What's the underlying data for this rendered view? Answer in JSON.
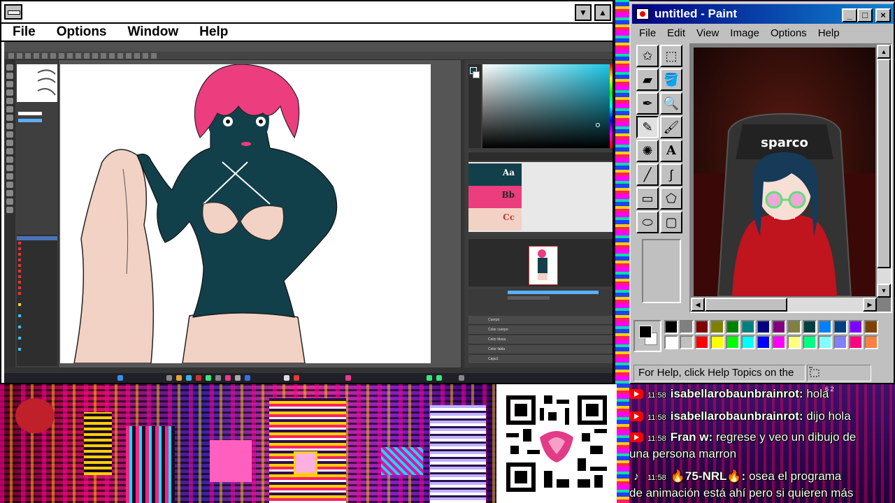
{
  "left_window": {
    "menu": [
      "File",
      "Options",
      "Window",
      "Help"
    ],
    "scroll_up": "▼",
    "scroll_down": "▲"
  },
  "paint": {
    "title": "untitled - Paint",
    "menu": [
      "File",
      "Edit",
      "View",
      "Image",
      "Options",
      "Help"
    ],
    "minimize": "_",
    "maximize": "□",
    "close": "×",
    "tools": [
      "free-select",
      "select",
      "eraser",
      "fill",
      "color-picker",
      "magnifier",
      "pencil",
      "brush",
      "airbrush",
      "text",
      "line",
      "curve",
      "rectangle",
      "polygon",
      "ellipse",
      "rounded-rectangle"
    ],
    "tool_glyphs": [
      "✩",
      "⬚",
      "▰",
      "🪣",
      "✒",
      "🔍",
      "✎",
      "🖌",
      "✺",
      "A",
      "╱",
      "∫",
      "▭",
      "⬠",
      "⬭",
      "▢"
    ],
    "active_tool": 6,
    "status": "For Help, click Help Topics on the",
    "sparco_text": "sparco",
    "palette_top": [
      "#000000",
      "#808080",
      "#800000",
      "#808000",
      "#008000",
      "#008080",
      "#000080",
      "#800080",
      "#808040",
      "#004040",
      "#0080ff",
      "#004080",
      "#8000ff",
      "#804000"
    ],
    "palette_bottom": [
      "#ffffff",
      "#c0c0c0",
      "#ff0000",
      "#ffff00",
      "#00ff00",
      "#00ffff",
      "#0000ff",
      "#ff00ff",
      "#ffff80",
      "#00ff80",
      "#80ffff",
      "#8080ff",
      "#ff0080",
      "#ff8040"
    ]
  },
  "csp": {
    "palette_labels": [
      "Aa",
      "Bb",
      "Cc"
    ],
    "palette_colors": [
      "#12404a",
      "#ec3d7e",
      "#f2d2c4"
    ],
    "layers": [
      "Cuerpo",
      "Color cuerpo",
      "Color blusa",
      "Color falda",
      "Capa1"
    ]
  },
  "chat": {
    "messages": [
      {
        "platform": "youtube",
        "time": "11:58",
        "user": "isabellarobaunbrainrot:",
        "text": "hola"
      },
      {
        "platform": "youtube",
        "time": "11:58",
        "user": "isabellarobaunbrainrot:",
        "text": "dijo hola"
      },
      {
        "platform": "youtube",
        "time": "11:58",
        "user": "Fran w:",
        "text": "regrese y veo un dibujo de"
      },
      {
        "platform": "none",
        "time": "",
        "user": "",
        "text": "una persona marron"
      },
      {
        "platform": "tiktok",
        "time": "11:58",
        "user": "🔥75-NRL🔥:",
        "text": "osea el programa"
      },
      {
        "platform": "none",
        "time": "",
        "user": "",
        "text": "de animación está ahí pero si quieren más"
      }
    ],
    "badge_counts": "6  2"
  }
}
